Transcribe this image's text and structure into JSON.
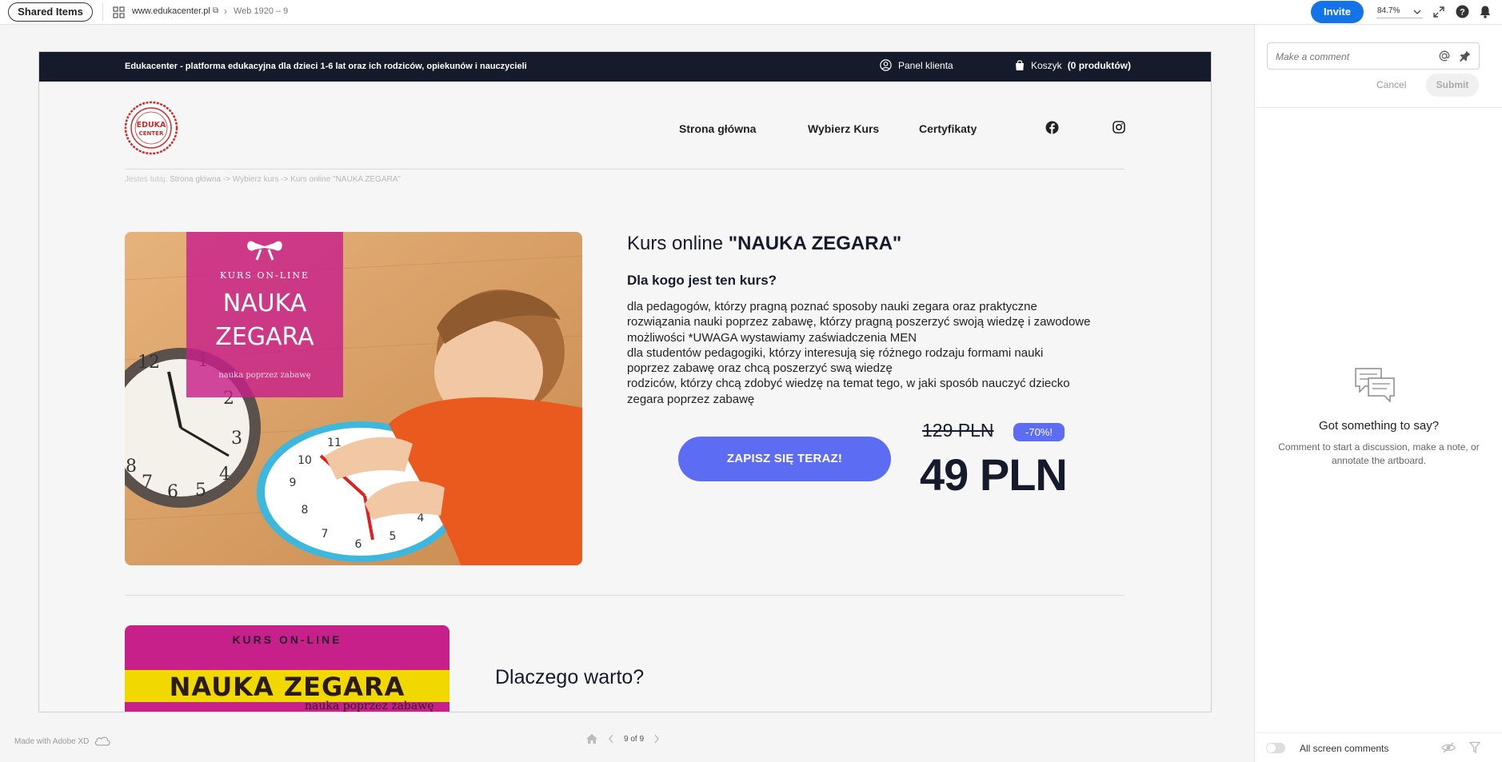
{
  "xd_toolbar": {
    "shared_label": "Shared Items",
    "url": "www.edukacenter.pl",
    "page": "Web 1920 – 9",
    "invite_label": "Invite",
    "zoom": "84.7%"
  },
  "site": {
    "tagline": "Edukacenter - platforma edukacyjna dla dzieci 1-6 lat oraz ich rodziców, opiekunów i nauczycieli",
    "panel_label": "Panel klienta",
    "cart_label": "Koszyk",
    "cart_count": "(0 produktów)",
    "logo_line1": "EDUKA",
    "logo_line2": "CENTER",
    "nav": [
      "Strona główna",
      "Wybierz Kurs",
      "Certyfikaty"
    ],
    "breadcrumb_prefix": "Jesteś tutaj:",
    "breadcrumb_path": "Strona główna -> Wybierz kurs -> Kurs online \"NAUKA ZEGARA\"",
    "hero": {
      "kurs_label": "KURS ON-LINE",
      "title_line1": "NAUKA",
      "title_line2": "ZEGARA",
      "subtitle": "nauka poprzez zabawę"
    },
    "course_title_prefix": "Kurs online ",
    "course_title_name": "\"NAUKA ZEGARA\"",
    "for_whom_heading": "Dla kogo jest ten kurs?",
    "description_lines": [
      "dla pedagogów, którzy pragną poznać sposoby nauki zegara oraz praktyczne",
      "rozwiązania nauki poprzez zabawę, którzy pragną poszerzyć swoją wiedzę i zawodowe",
      "możliwości *UWAGA wystawiamy zaświadczenia MEN",
      "dla studentów pedagogiki, którzy interesują się różnego rodzaju formami nauki",
      "poprzez zabawę oraz chcą poszerzyć swą wiedzę",
      "rodziców, którzy chcą zdobyć wiedzę na temat tego, w jaki sposób nauczyć dziecko",
      "zegara poprzez zabawę"
    ],
    "cta_label": "ZAPISZ SIĘ TERAZ!",
    "old_price": "129 PLN",
    "discount": "-70%!",
    "new_price": "49 PLN",
    "card2": {
      "kurs_label": "KURS ON-LINE",
      "title": "NAUKA ZEGARA",
      "subtitle": "nauka poprzez zabawę"
    },
    "why_heading": "Dlaczego warto?"
  },
  "xd_footer": {
    "made_with": "Made with Adobe XD",
    "pager": "9 of 9"
  },
  "comments": {
    "placeholder": "Make a comment",
    "cancel_label": "Cancel",
    "submit_label": "Submit",
    "empty_title": "Got something to say?",
    "empty_desc": "Comment to start a discussion, make a note, or annotate the artboard.",
    "all_screen_label": "All screen comments"
  },
  "colors": {
    "accent": "#5c6cf3",
    "xd_blue": "#1473e6",
    "site_dark": "#161b2b",
    "hero_pink": "#c8208a",
    "card_yellow": "#f1d900"
  }
}
